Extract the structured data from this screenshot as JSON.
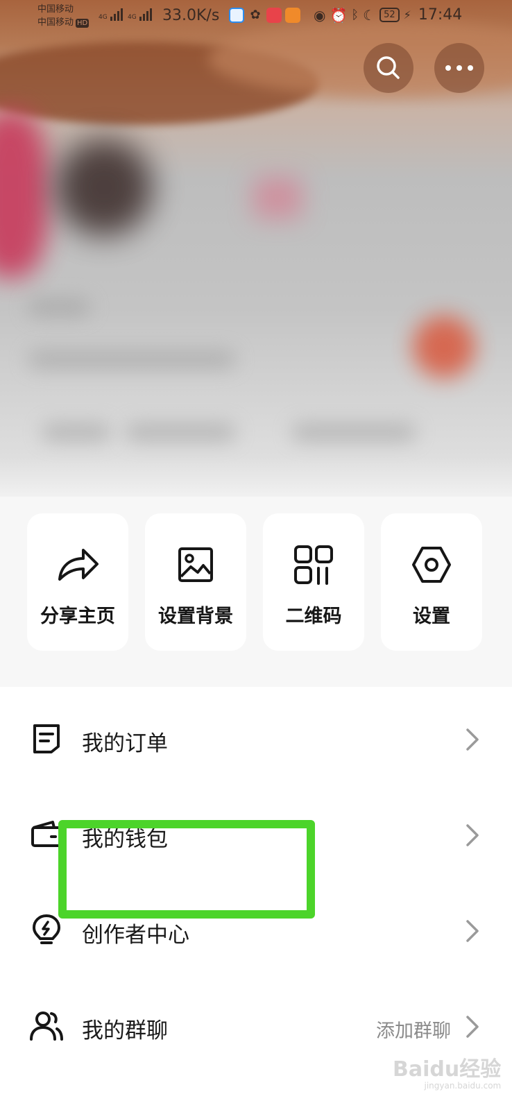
{
  "status_bar": {
    "carrier_1": "中国移动",
    "carrier_2": "中国移动",
    "carrier_2_badge": "HD",
    "network_1": "4G",
    "network_2": "4G",
    "speed": "33.0K/s",
    "battery": "52",
    "time": "17:44"
  },
  "header": {
    "search_icon": "search-icon",
    "more_icon": "more-icon"
  },
  "quick_actions": [
    {
      "label": "分享主页",
      "icon": "share-icon"
    },
    {
      "label": "设置背景",
      "icon": "image-icon"
    },
    {
      "label": "二维码",
      "icon": "qrcode-icon"
    },
    {
      "label": "设置",
      "icon": "settings-icon"
    }
  ],
  "menu": [
    {
      "label": "我的订单",
      "icon": "order-icon",
      "extra": ""
    },
    {
      "label": "我的钱包",
      "icon": "wallet-icon",
      "extra": ""
    },
    {
      "label": "创作者中心",
      "icon": "lightbulb-icon",
      "extra": ""
    },
    {
      "label": "我的群聊",
      "icon": "group-icon",
      "extra": "添加群聊"
    }
  ],
  "annotation": {
    "highlight_color": "#4cd42a"
  },
  "watermark": {
    "text": "Baidu经验",
    "sub": "jingyan.baidu.com"
  }
}
